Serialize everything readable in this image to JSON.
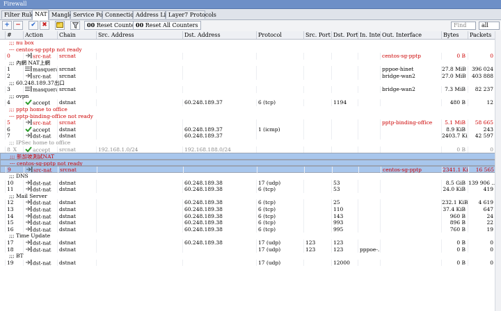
{
  "window": {
    "title": "Firewall"
  },
  "tabs": [
    {
      "label": "Filter Rules",
      "active": false
    },
    {
      "label": "NAT",
      "active": true
    },
    {
      "label": "Mangle",
      "active": false
    },
    {
      "label": "Service Ports",
      "active": false
    },
    {
      "label": "Connections",
      "active": false
    },
    {
      "label": "Address Lists",
      "active": false
    },
    {
      "label": "Layer7 Protocols",
      "active": false
    }
  ],
  "toolbar": {
    "add": "+",
    "remove": "−",
    "enable": "✔",
    "disable": "✖",
    "reset_counters": "Reset Counters",
    "reset_all_counters": "Reset All Counters",
    "counter_prefix": "00",
    "find_placeholder": "Find",
    "filter_value": "all"
  },
  "columns": [
    "#",
    "Action",
    "Chain",
    "Src. Address",
    "Dst. Address",
    "Protocol",
    "Src. Port",
    "Dst. Port",
    "In. Inte...",
    "Out. Interface",
    "Bytes",
    "Packets"
  ],
  "rows": [
    {
      "type": "comment",
      "text": ";;; nu box",
      "color": "red"
    },
    {
      "type": "comment",
      "text": "--- centos-sg-pptp not ready",
      "color": "red"
    },
    {
      "type": "rule",
      "num": "0",
      "icon": "srcnat-icon",
      "action": "src-nat",
      "chain": "srcnat",
      "src": "",
      "dst": "",
      "proto": "",
      "sport": "",
      "dport": "",
      "in": "",
      "out": "centos-sg-pptp",
      "bytes": "0 B",
      "packets": "0",
      "color": "red"
    },
    {
      "type": "comment",
      "text": ";;; 內網 NAT上網",
      "color": ""
    },
    {
      "type": "rule",
      "num": "1",
      "icon": "masquerade-icon",
      "action": "masquera...",
      "chain": "srcnat",
      "src": "",
      "dst": "",
      "proto": "",
      "sport": "",
      "dport": "",
      "in": "",
      "out": "pppoe-hinet",
      "bytes": "27.8 MiB",
      "packets": "396 024",
      "color": ""
    },
    {
      "type": "rule",
      "num": "2",
      "icon": "srcnat-icon",
      "action": "src-nat",
      "chain": "srcnat",
      "src": "",
      "dst": "",
      "proto": "",
      "sport": "",
      "dport": "",
      "in": "",
      "out": "bridge-wan2",
      "bytes": "27.0 MiB",
      "packets": "403 888",
      "color": ""
    },
    {
      "type": "comment",
      "text": ";;; 60.248.189.37出口",
      "color": ""
    },
    {
      "type": "rule",
      "num": "3",
      "icon": "masquerade-icon",
      "action": "masquera...",
      "chain": "srcnat",
      "src": "",
      "dst": "",
      "proto": "",
      "sport": "",
      "dport": "",
      "in": "",
      "out": "bridge-wan2",
      "bytes": "7.3 MiB",
      "packets": "82 237",
      "color": ""
    },
    {
      "type": "comment",
      "text": ";;; ovpn",
      "color": ""
    },
    {
      "type": "rule",
      "num": "4",
      "icon": "accept-icon",
      "action": "accept",
      "chain": "dstnat",
      "src": "",
      "dst": "60.248.189.37",
      "proto": "6 (tcp)",
      "sport": "",
      "dport": "1194",
      "in": "",
      "out": "",
      "bytes": "480 B",
      "packets": "12",
      "color": ""
    },
    {
      "type": "comment",
      "text": ";;; pptp home to office",
      "color": "red"
    },
    {
      "type": "comment",
      "text": "--- pptp-binding-office not ready",
      "color": "red"
    },
    {
      "type": "rule",
      "num": "5",
      "icon": "srcnat-icon",
      "action": "src-nat",
      "chain": "srcnat",
      "src": "",
      "dst": "",
      "proto": "",
      "sport": "",
      "dport": "",
      "in": "",
      "out": "pptp-binding-office",
      "bytes": "5.1 MiB",
      "packets": "58 665",
      "color": "red"
    },
    {
      "type": "rule",
      "num": "6",
      "icon": "accept-icon",
      "action": "accept",
      "chain": "dstnat",
      "src": "",
      "dst": "60.248.189.37",
      "proto": "1 (icmp)",
      "sport": "",
      "dport": "",
      "in": "",
      "out": "",
      "bytes": "8.9 KiB",
      "packets": "243",
      "color": ""
    },
    {
      "type": "rule",
      "num": "7",
      "icon": "dstnat-icon",
      "action": "dst-nat",
      "chain": "dstnat",
      "src": "",
      "dst": "60.248.189.37",
      "proto": "",
      "sport": "",
      "dport": "",
      "in": "",
      "out": "",
      "bytes": "2403.7 KiB",
      "packets": "42 597",
      "color": ""
    },
    {
      "type": "comment",
      "text": ";;; IPSec home to office",
      "color": "grey"
    },
    {
      "type": "rule",
      "num": "8",
      "flag": "X",
      "icon": "accept-icon",
      "action": "accept",
      "chain": "srcnat",
      "src": "192.168.1.0/24",
      "dst": "192.168.188.0/24",
      "proto": "",
      "sport": "",
      "dport": "",
      "in": "",
      "out": "",
      "bytes": "0 B",
      "packets": "0",
      "color": "grey"
    },
    {
      "type": "comment",
      "text": ";;; 新加坡測試NAT",
      "color": "red",
      "selected": true
    },
    {
      "type": "comment",
      "text": "--- centos-sg-pptp not ready",
      "color": "red",
      "selected": true
    },
    {
      "type": "rule",
      "num": "9",
      "icon": "srcnat-icon",
      "action": "src-nat",
      "chain": "srcnat",
      "src": "",
      "dst": "",
      "proto": "",
      "sport": "",
      "dport": "",
      "in": "",
      "out": "centos-sg-pptp",
      "bytes": "2341.1 KiB",
      "packets": "16 565",
      "color": "red",
      "selected": true
    },
    {
      "type": "comment",
      "text": ";;; DNS",
      "color": ""
    },
    {
      "type": "rule",
      "num": "10",
      "icon": "dstnat-icon",
      "action": "dst-nat",
      "chain": "dstnat",
      "src": "",
      "dst": "60.248.189.38",
      "proto": "17 (udp)",
      "sport": "",
      "dport": "53",
      "in": "",
      "out": "",
      "bytes": "8.5 GiB",
      "packets": "139 906 ...",
      "color": ""
    },
    {
      "type": "rule",
      "num": "11",
      "icon": "dstnat-icon",
      "action": "dst-nat",
      "chain": "dstnat",
      "src": "",
      "dst": "60.248.189.38",
      "proto": "6 (tcp)",
      "sport": "",
      "dport": "53",
      "in": "",
      "out": "",
      "bytes": "24.0 KiB",
      "packets": "419",
      "color": ""
    },
    {
      "type": "comment",
      "text": ";;; Mail Server",
      "color": ""
    },
    {
      "type": "rule",
      "num": "12",
      "icon": "dstnat-icon",
      "action": "dst-nat",
      "chain": "dstnat",
      "src": "",
      "dst": "60.248.189.38",
      "proto": "6 (tcp)",
      "sport": "",
      "dport": "25",
      "in": "",
      "out": "",
      "bytes": "232.1 KiB",
      "packets": "4 619",
      "color": ""
    },
    {
      "type": "rule",
      "num": "13",
      "icon": "dstnat-icon",
      "action": "dst-nat",
      "chain": "dstnat",
      "src": "",
      "dst": "60.248.189.38",
      "proto": "6 (tcp)",
      "sport": "",
      "dport": "110",
      "in": "",
      "out": "",
      "bytes": "37.4 KiB",
      "packets": "647",
      "color": ""
    },
    {
      "type": "rule",
      "num": "14",
      "icon": "dstnat-icon",
      "action": "dst-nat",
      "chain": "dstnat",
      "src": "",
      "dst": "60.248.189.38",
      "proto": "6 (tcp)",
      "sport": "",
      "dport": "143",
      "in": "",
      "out": "",
      "bytes": "960 B",
      "packets": "24",
      "color": ""
    },
    {
      "type": "rule",
      "num": "15",
      "icon": "dstnat-icon",
      "action": "dst-nat",
      "chain": "dstnat",
      "src": "",
      "dst": "60.248.189.38",
      "proto": "6 (tcp)",
      "sport": "",
      "dport": "993",
      "in": "",
      "out": "",
      "bytes": "896 B",
      "packets": "22",
      "color": ""
    },
    {
      "type": "rule",
      "num": "16",
      "icon": "dstnat-icon",
      "action": "dst-nat",
      "chain": "dstnat",
      "src": "",
      "dst": "60.248.189.38",
      "proto": "6 (tcp)",
      "sport": "",
      "dport": "995",
      "in": "",
      "out": "",
      "bytes": "760 B",
      "packets": "19",
      "color": ""
    },
    {
      "type": "comment",
      "text": ";;; Time Update",
      "color": ""
    },
    {
      "type": "rule",
      "num": "17",
      "icon": "dstnat-icon",
      "action": "dst-nat",
      "chain": "dstnat",
      "src": "",
      "dst": "60.248.189.38",
      "proto": "17 (udp)",
      "sport": "123",
      "dport": "123",
      "in": "",
      "out": "",
      "bytes": "0 B",
      "packets": "0",
      "color": ""
    },
    {
      "type": "rule",
      "num": "18",
      "icon": "dstnat-icon",
      "action": "dst-nat",
      "chain": "dstnat",
      "src": "",
      "dst": "",
      "proto": "17 (udp)",
      "sport": "123",
      "dport": "123",
      "in": "pppoe-...",
      "out": "",
      "bytes": "0 B",
      "packets": "0",
      "color": ""
    },
    {
      "type": "comment",
      "text": ";;; BT",
      "color": ""
    },
    {
      "type": "rule",
      "num": "19",
      "icon": "dstnat-icon",
      "action": "dst-nat",
      "chain": "dstnat",
      "src": "",
      "dst": "",
      "proto": "17 (udp)",
      "sport": "",
      "dport": "12000",
      "in": "",
      "out": "",
      "bytes": "0 B",
      "packets": "0",
      "color": ""
    }
  ],
  "colors": {
    "titlebar": "#6d8fc7",
    "selected_row": "#a8c6ec",
    "comment_red": "#cc0000",
    "disabled_grey": "#8a8a8a",
    "accept_green": "#2e9e2e",
    "add_blue": "#1f5fc9",
    "remove_red": "#c92020"
  }
}
